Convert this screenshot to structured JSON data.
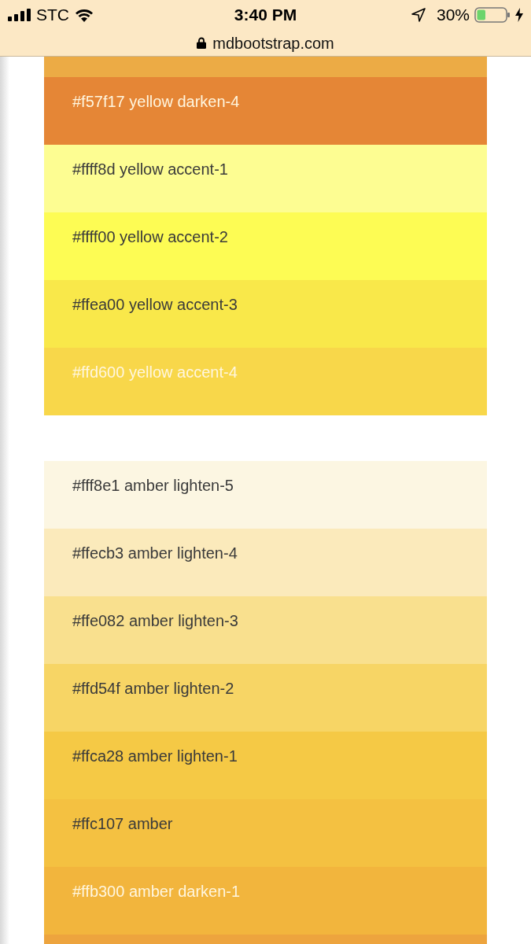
{
  "status_bar": {
    "carrier": "STC",
    "time": "3:40 PM",
    "battery": "30%"
  },
  "address_bar": {
    "url": "mdbootstrap.com"
  },
  "groups": [
    {
      "swatches": [
        {
          "kind": "blank",
          "color": "#ecab45"
        },
        {
          "kind": "light",
          "color": "#e58636",
          "label": "#f57f17 yellow darken-4"
        },
        {
          "kind": "dark",
          "color": "#fdfd92",
          "label": "#ffff8d yellow accent-1"
        },
        {
          "kind": "dark",
          "color": "#fdfc54",
          "label": "#ffff00 yellow accent-2"
        },
        {
          "kind": "dark",
          "color": "#f9e84a",
          "label": "#ffea00 yellow accent-3"
        },
        {
          "kind": "light",
          "color": "#f8d74a",
          "label": "#ffd600 yellow accent-4"
        }
      ]
    },
    {
      "swatches": [
        {
          "kind": "dark",
          "color": "#fcf6e2",
          "label": "#fff8e1 amber lighten-5"
        },
        {
          "kind": "dark",
          "color": "#fbeabb",
          "label": "#ffecb3 amber lighten-4"
        },
        {
          "kind": "dark",
          "color": "#f9e08e",
          "label": "#ffe082 amber lighten-3"
        },
        {
          "kind": "dark",
          "color": "#f7d565",
          "label": "#ffd54f amber lighten-2"
        },
        {
          "kind": "dark",
          "color": "#f5c945",
          "label": "#ffca28 amber lighten-1"
        },
        {
          "kind": "dark",
          "color": "#f4c141",
          "label": "#ffc107 amber"
        },
        {
          "kind": "light",
          "color": "#f2b53d",
          "label": "#ffb300 amber darken-1"
        },
        {
          "kind": "blank",
          "color": "#eda43e"
        }
      ]
    }
  ]
}
